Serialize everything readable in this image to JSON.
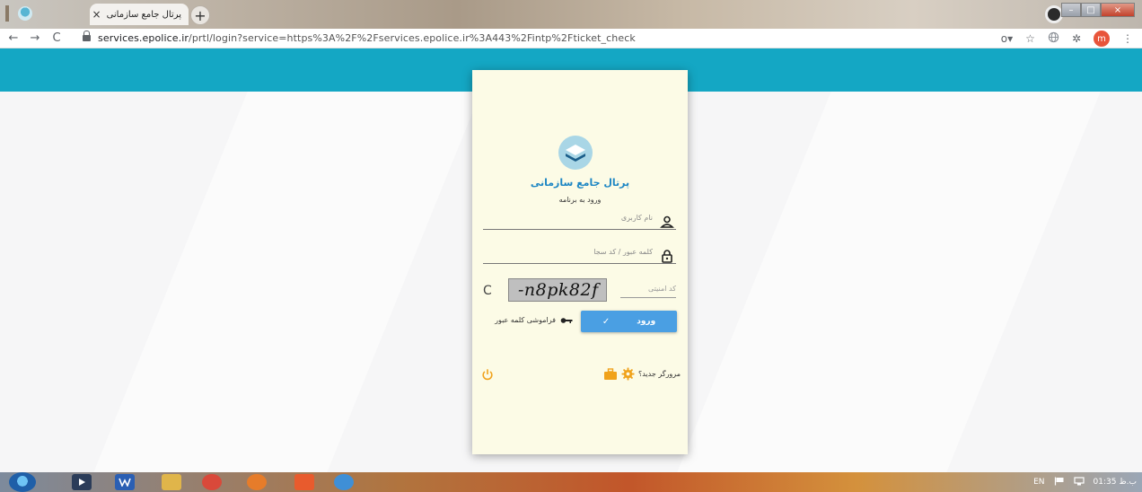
{
  "browser": {
    "tab_title": "پرتال جامع سازمانی",
    "tab_close": "×",
    "new_tab": "+",
    "url_host": "services.epolice.ir",
    "url_path": "/prtl/login?service=https%3A%2F%2Fservices.epolice.ir%3A443%2Fintp%2Fticket_check",
    "back": "←",
    "forward": "→",
    "reload": "C",
    "key_glyph": "o▾",
    "star": "☆",
    "puzzle": "✲",
    "avatar_letter": "m",
    "menu": "⋮",
    "win_min": "–",
    "win_max": "□",
    "win_close": "×"
  },
  "login": {
    "title": "پرتال جامع سازمانی",
    "subtitle": "ورود به برنامه",
    "username_placeholder": "نام کاربری",
    "password_placeholder": "کلمه عبور / کد سجا",
    "captcha_placeholder": "کد امنیتی",
    "captcha_text": "-n8pk82f",
    "refresh": "C",
    "login_label": "ورود",
    "check": "✓",
    "forgot_label": "فراموشی کلمه عبور",
    "new_browser_label": "مرورگر جدید؟"
  },
  "colors": {
    "band": "#14a7c4",
    "card": "#fcfbe6",
    "primary_button": "#4a9fe3",
    "title": "#1d86c4",
    "footer_icons": "#f0a21b"
  },
  "taskbar": {
    "lang": "EN",
    "time": "01:35",
    "time_suffix": "ب.ظ"
  }
}
